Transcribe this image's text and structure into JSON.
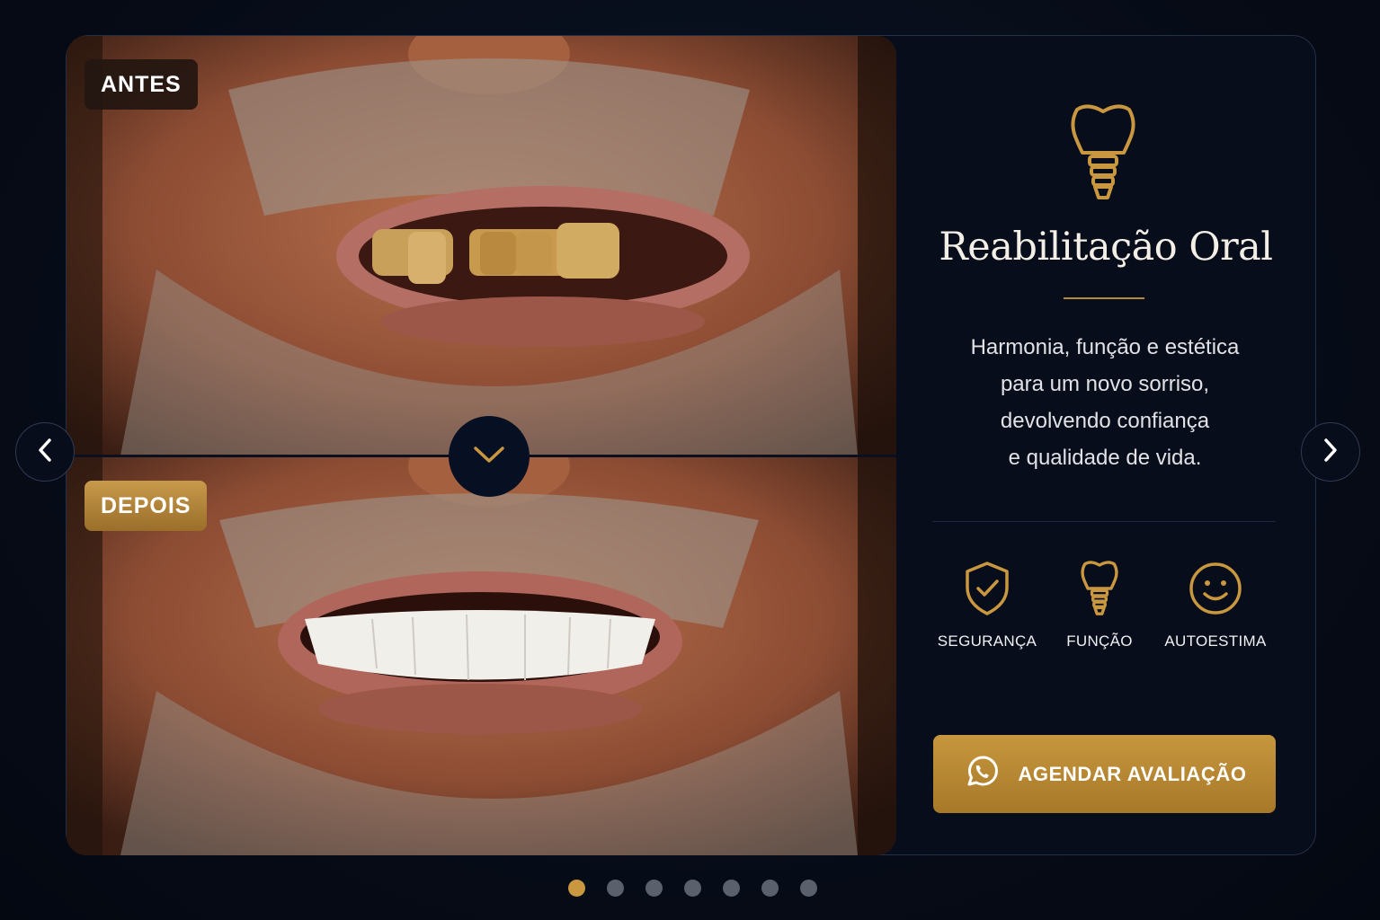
{
  "slide": {
    "before_label": "ANTES",
    "after_label": "DEPOIS",
    "title": "Reabilitação Oral",
    "description": [
      "Harmonia, função e estética",
      "para um novo sorriso,",
      "devolvendo confiança",
      "e qualidade de vida."
    ],
    "features": [
      {
        "label": "SEGURANÇA",
        "icon": "shield-check-icon"
      },
      {
        "label": "FUNÇÃO",
        "icon": "dental-implant-icon"
      },
      {
        "label": "AUTOESTIMA",
        "icon": "smiley-face-icon"
      }
    ],
    "cta_label": "AGENDAR AVALIAÇÃO",
    "cta_icon": "whatsapp-icon"
  },
  "carousel": {
    "total_slides": 7,
    "active_index": 0,
    "prev_icon": "chevron-left-icon",
    "next_icon": "chevron-right-icon",
    "toggle_icon": "chevron-down-icon"
  },
  "colors": {
    "accent_gold": "#c9973f",
    "background": "#070d1b",
    "text_light": "#f4efe6"
  }
}
